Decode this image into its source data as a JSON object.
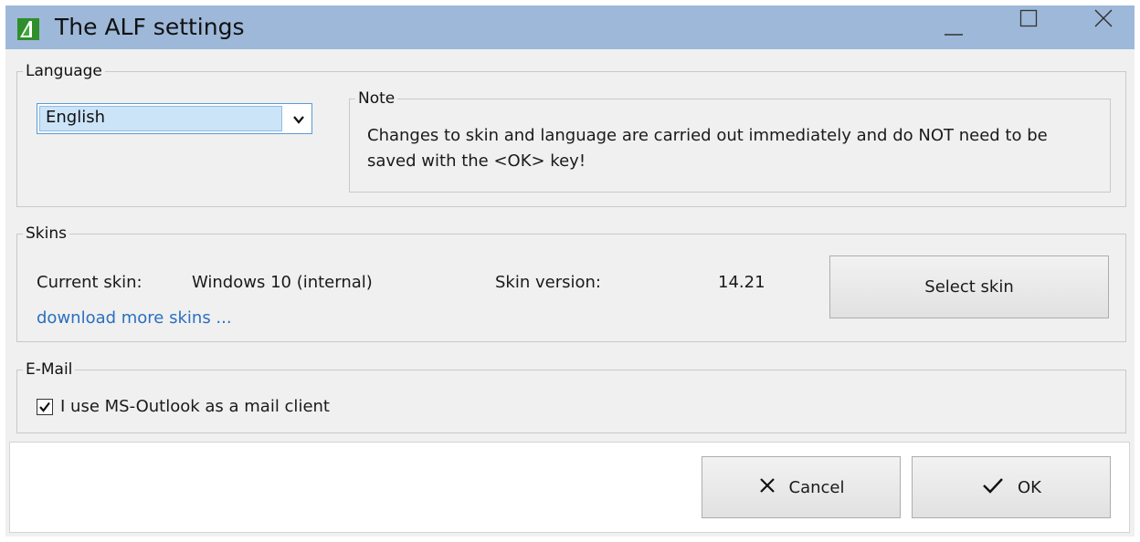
{
  "window": {
    "title": "The ALF settings"
  },
  "language": {
    "group_label": "Language",
    "selected": "English",
    "note": {
      "label": "Note",
      "text": "Changes to skin and language are carried out immediately and do NOT need to be saved with the <OK> key!"
    }
  },
  "skins": {
    "group_label": "Skins",
    "current_label": "Current skin:",
    "current_value": "Windows 10 (internal)",
    "version_label": "Skin version:",
    "version_value": "14.21",
    "download_link": "download more skins ...",
    "select_button": "Select skin"
  },
  "email": {
    "group_label": "E-Mail",
    "checkbox_label": "I use MS-Outlook as a mail client",
    "checked": true
  },
  "footer": {
    "cancel_label": "Cancel",
    "ok_label": "OK"
  },
  "colors": {
    "titlebar": "#9eb8d9",
    "accent": "#5a9bd5",
    "link": "#2a6fc0",
    "app_icon": "#3dab3a"
  }
}
